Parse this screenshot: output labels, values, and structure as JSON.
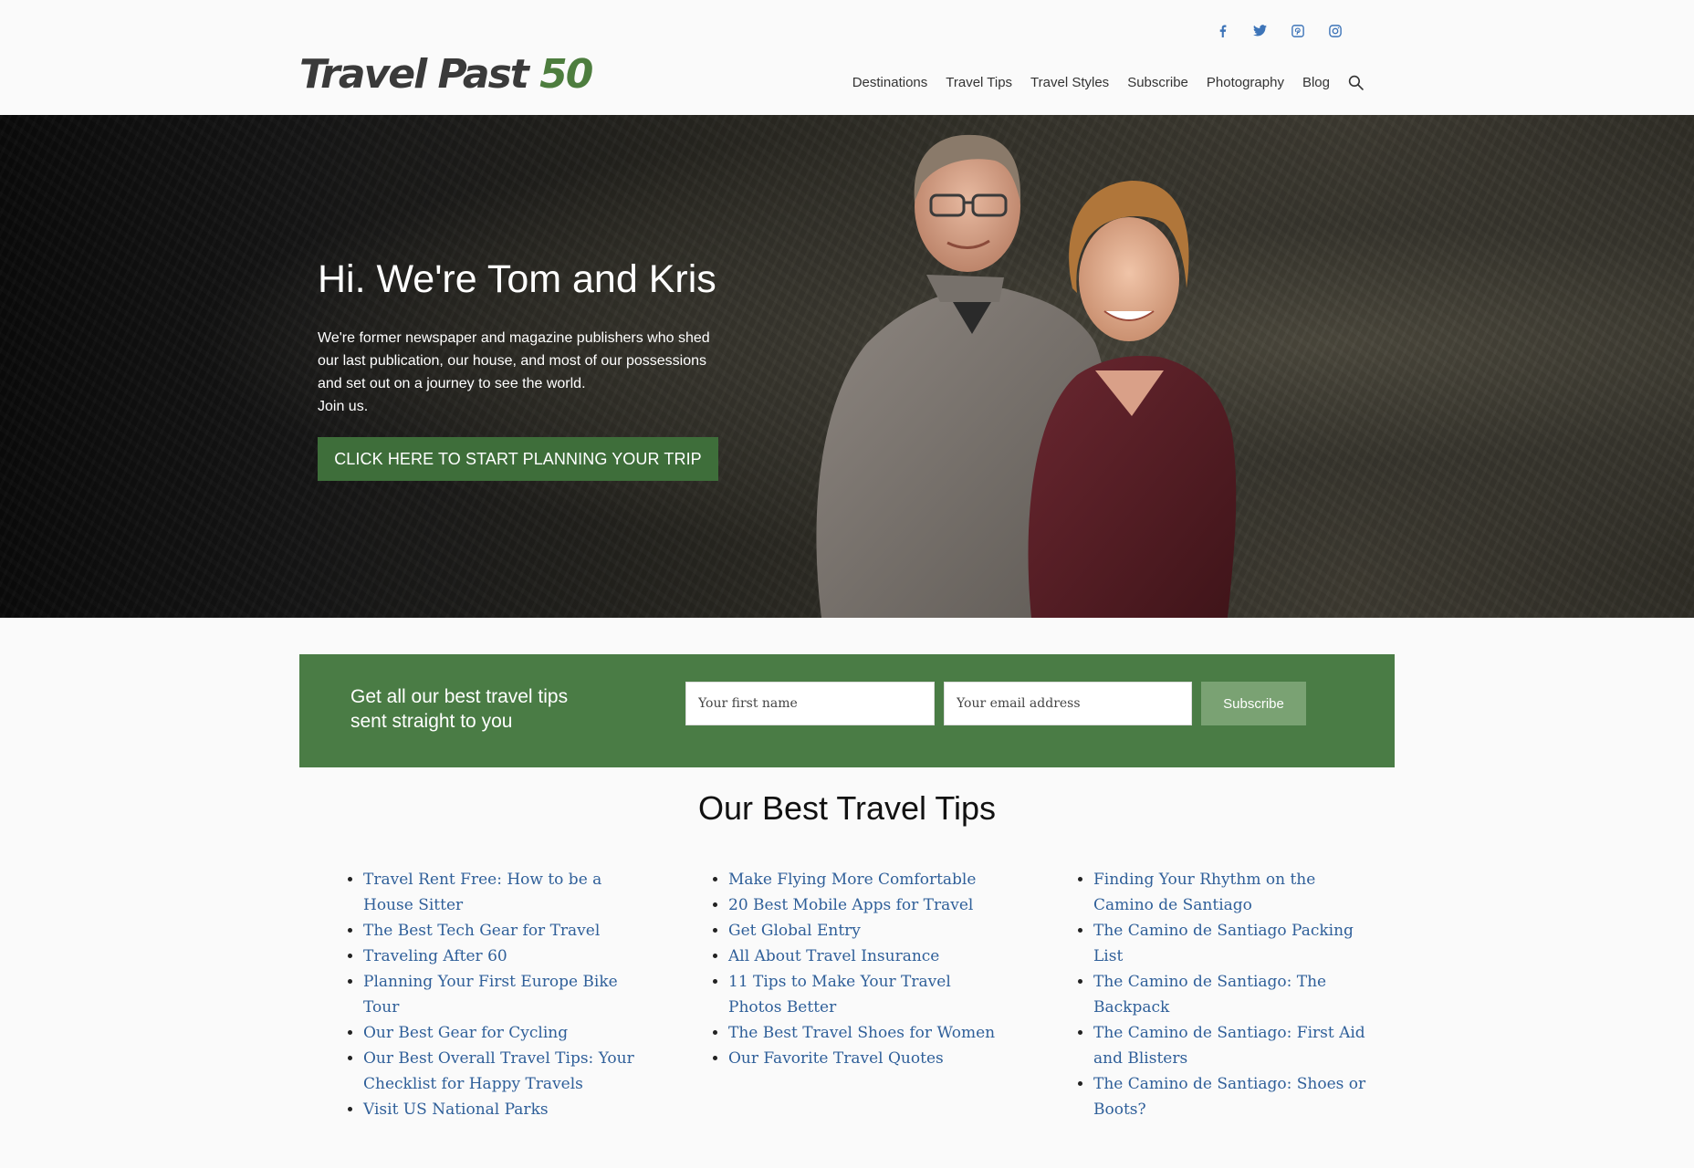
{
  "header": {
    "logo": {
      "part1": "Travel Past ",
      "part2": "50"
    },
    "social": [
      "facebook-icon",
      "twitter-icon",
      "pinterest-icon",
      "instagram-icon"
    ],
    "nav": [
      "Destinations",
      "Travel Tips",
      "Travel Styles",
      "Subscribe",
      "Photography",
      "Blog"
    ],
    "search_icon": "search-icon"
  },
  "hero": {
    "title": "Hi. We're Tom and Kris",
    "description_lines": [
      "We're former newspaper and magazine publishers who shed",
      "our last publication, our house, and most of our possessions",
      "and set out on a journey to see the world.",
      "Join us."
    ],
    "cta": "CLICK HERE TO START PLANNING YOUR TRIP"
  },
  "signup": {
    "text_lines": [
      "Get all our best travel tips",
      "sent straight to you"
    ],
    "first_name_placeholder": "Your first name",
    "email_placeholder": "Your email address",
    "button": "Subscribe"
  },
  "tips": {
    "title": "Our Best Travel Tips",
    "columns": [
      [
        "Travel Rent Free: How to be a House Sitter",
        "The Best Tech Gear for Travel",
        "Traveling After 60",
        "Planning Your First Europe Bike Tour",
        "Our Best Gear for Cycling",
        "Our Best Overall Travel Tips: Your Checklist for Happy Travels",
        "Visit US National Parks"
      ],
      [
        "Make Flying More Comfortable",
        "20 Best Mobile Apps for Travel",
        "Get Global Entry",
        "All About Travel Insurance",
        "11 Tips to Make Your Travel Photos Better",
        "The Best Travel Shoes for Women",
        "Our Favorite Travel Quotes"
      ],
      [
        "Finding Your Rhythm on the Camino de Santiago",
        "The Camino de Santiago Packing List",
        "The Camino de Santiago: The Backpack",
        "The Camino de Santiago: First Aid and Blisters",
        "The Camino de Santiago: Shoes or Boots?"
      ]
    ]
  },
  "colors": {
    "brand_green": "#4a7c45",
    "link_blue": "#2f5f99",
    "social_blue": "#3d74b8"
  }
}
